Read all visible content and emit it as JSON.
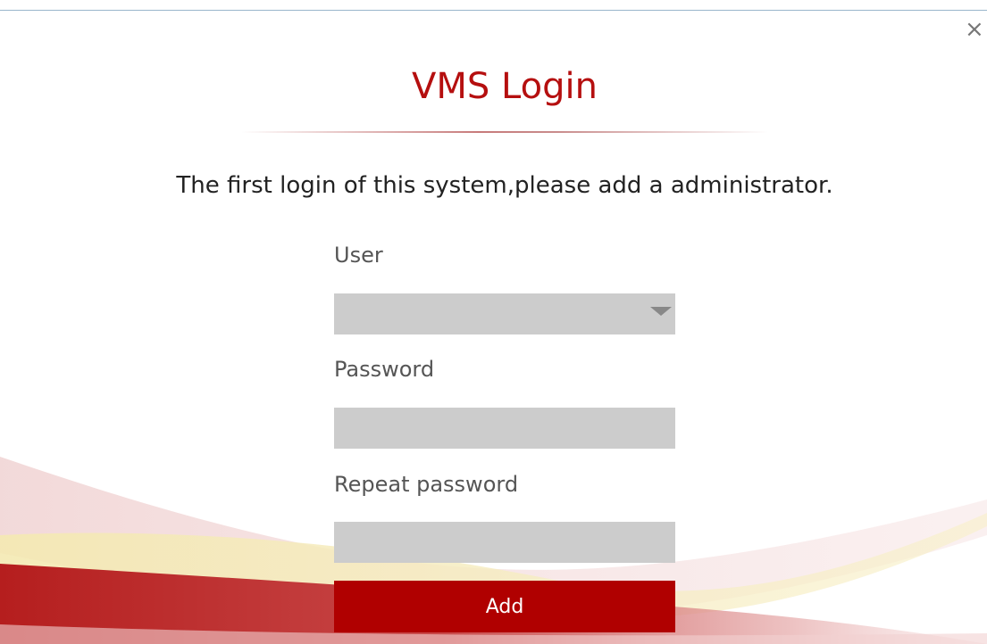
{
  "window": {
    "close_icon": "close-icon",
    "close_glyph": "×"
  },
  "login": {
    "title": "VMS Login",
    "subtitle": "The first login of this system,please add a administrator."
  },
  "form": {
    "user_label": "User",
    "user_value": "",
    "password_label": "Password",
    "password_value": "",
    "repeat_password_label": "Repeat password",
    "repeat_password_value": "",
    "add_button_label": "Add"
  },
  "colors": {
    "accent": "#b00000",
    "title": "#b50f0f",
    "field_background": "#cccccc",
    "wave_red": "#b51e1e",
    "wave_yellow": "#f2e7a8"
  }
}
